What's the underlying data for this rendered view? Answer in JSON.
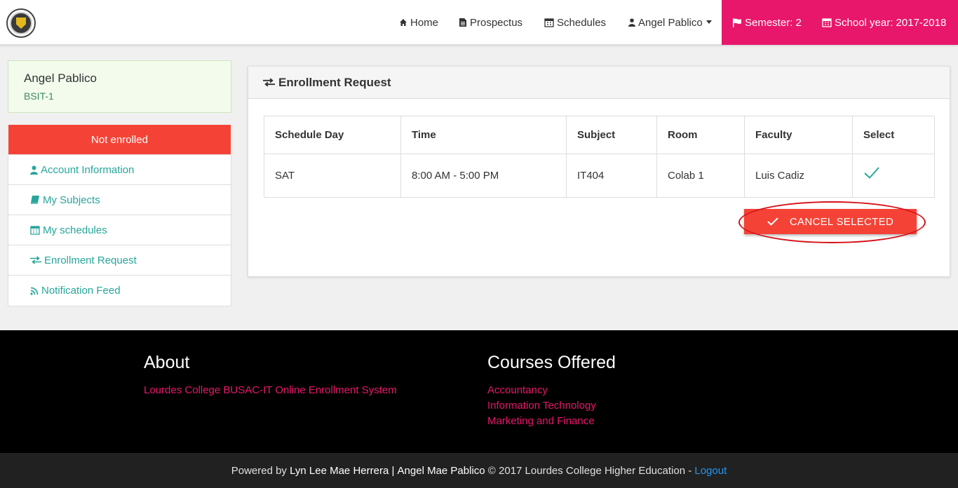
{
  "nav": {
    "home": "Home",
    "prospectus": "Prospectus",
    "schedules": "Schedules",
    "user": "Angel Pablico",
    "semester": "Semester: 2",
    "school_year": "School year: 2017-2018"
  },
  "profile": {
    "name": "Angel Pablico",
    "course": "BSIT-1"
  },
  "status": "Not enrolled",
  "sidebar": {
    "items": [
      {
        "label": "Account Information",
        "icon": "user-icon"
      },
      {
        "label": "My Subjects",
        "icon": "book-icon"
      },
      {
        "label": "My schedules",
        "icon": "calendar-icon"
      },
      {
        "label": "Enrollment Request",
        "icon": "exchange-icon"
      },
      {
        "label": "Notification Feed",
        "icon": "rss-icon"
      }
    ]
  },
  "panel": {
    "title": "Enrollment Request",
    "columns": [
      "Schedule Day",
      "Time",
      "Subject",
      "Room",
      "Faculty",
      "Select"
    ],
    "rows": [
      {
        "day": "SAT",
        "time": "8:00 AM - 5:00 PM",
        "subject": "IT404",
        "room": "Colab 1",
        "faculty": "Luis Cadiz",
        "selected": true
      }
    ],
    "cancel_label": "CANCEL SELECTED"
  },
  "footer": {
    "about_title": "About",
    "about_text": "Lourdes College BUSAC-IT Online Enrollment System",
    "courses_title": "Courses Offered",
    "courses": [
      "Accountancy",
      "Information Technology",
      "Marketing and Finance"
    ]
  },
  "bottom": {
    "powered": "Powered by",
    "author1": "Lyn Lee Mae Herrera",
    "sep": "|",
    "author2": "Angel Mae Pablico",
    "copyright": "© 2017 Lourdes College Higher Education -",
    "logout": "Logout"
  },
  "colors": {
    "accent_pink": "#e8176b",
    "danger_red": "#f44336",
    "teal": "#26a69a"
  }
}
